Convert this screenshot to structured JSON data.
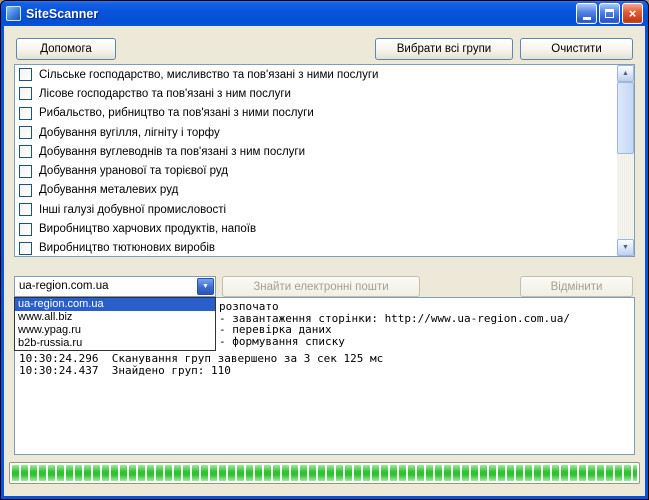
{
  "window": {
    "title": "SiteScanner"
  },
  "toolbar": {
    "help": "Допомога",
    "select_all": "Вибрати всі групи",
    "clear": "Очистити"
  },
  "categories": [
    "Сільське господарство, мисливство та пов'язані з ними послуги",
    "Лісове господарство та пов'язані з ним послуги",
    "Рибальство, рибництво та пов'язані з ними послуги",
    "Добування вугілля, лігніту і торфу",
    "Добування вуглеводнів та пов'язані з ним послуги",
    "Добування уранової та торієвої руд",
    "Добування металевих руд",
    "Інші галузі добувної промисловості",
    "Виробництво харчових продуктів, напоїв",
    "Виробництво тютюнових виробів"
  ],
  "combo": {
    "value": "ua-region.com.ua",
    "options": [
      "ua-region.com.ua",
      "www.all.biz",
      "www.ypag.ru",
      "b2b-russia.ru"
    ],
    "selected_index": 0
  },
  "actions": {
    "find_emails": "Знайти електронні пошти",
    "cancel": "Відмінити"
  },
  "log": {
    "lines": [
      "розпочато",
      "- завантаження сторінки: http://www.ua-region.com.ua/",
      "- перевірка даних",
      "- формування списку",
      "10:30:24.296  Сканування груп завершено за 3 сек 125 мс",
      "10:30:24.437  Знайдено груп: 110"
    ]
  },
  "progress": {
    "percent": 100
  },
  "icons": {
    "close_glyph": "×",
    "combo_arrow": "▼",
    "scroll_up": "▲",
    "scroll_down": "▼"
  },
  "colors": {
    "titlebar_blue": "#0855DE",
    "selection_blue": "#2A5FCB",
    "progress_green": "#2FC32F",
    "window_gray": "#ECE9D8"
  }
}
